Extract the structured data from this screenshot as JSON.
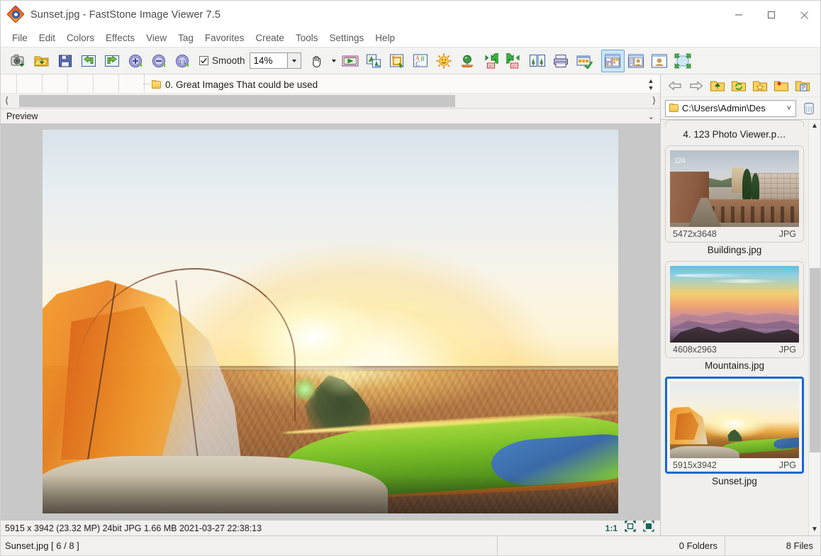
{
  "window": {
    "title": "Sunset.jpg  -  FastStone Image Viewer 7.5",
    "app_icon": "faststone-logo-icon",
    "controls": {
      "minimize": "minimize-button",
      "maximize": "maximize-button",
      "close": "close-button"
    }
  },
  "menubar": {
    "items": [
      "File",
      "Edit",
      "Colors",
      "Effects",
      "View",
      "Tag",
      "Favorites",
      "Create",
      "Tools",
      "Settings",
      "Help"
    ]
  },
  "toolbar": {
    "buttons": [
      {
        "name": "capture-screen-icon"
      },
      {
        "name": "open-folder-icon"
      },
      {
        "name": "save-as-icon"
      },
      {
        "name": "previous-image-icon"
      },
      {
        "name": "next-image-icon"
      },
      {
        "name": "zoom-in-icon"
      },
      {
        "name": "zoom-out-icon"
      },
      {
        "name": "actual-size-icon"
      }
    ],
    "smooth": {
      "label": "Smooth",
      "checked": true
    },
    "zoom": {
      "value": "14%",
      "dropdown": "zoom-dropdown-caret"
    },
    "buttons2": [
      {
        "name": "pan-hand-icon"
      },
      {
        "name": "slideshow-icon"
      },
      {
        "name": "resize-resample-icon"
      },
      {
        "name": "crop-board-icon"
      },
      {
        "name": "draw-text-icon"
      },
      {
        "name": "adjust-lighting-icon"
      },
      {
        "name": "red-eye-removal-icon"
      },
      {
        "name": "rotate-left-icon"
      },
      {
        "name": "rotate-right-icon"
      },
      {
        "name": "compare-images-icon"
      },
      {
        "name": "print-icon"
      },
      {
        "name": "email-icon"
      },
      {
        "name": "thumbnail-view-icon"
      },
      {
        "name": "filmstrip-view-icon"
      },
      {
        "name": "preview-only-icon"
      },
      {
        "name": "fullscreen-icon"
      }
    ]
  },
  "tree": {
    "folder_label": "0. Great Images That  could be used",
    "folder_icon": "folder-icon",
    "spinner": "tree-spinner"
  },
  "preview_panel": {
    "header_label": "Preview",
    "collapse_icon": "double-chevron-down-icon"
  },
  "navbar": {
    "buttons": [
      {
        "name": "back-arrow-icon"
      },
      {
        "name": "forward-arrow-icon"
      },
      {
        "name": "up-folder-icon"
      },
      {
        "name": "refresh-folder-icon"
      },
      {
        "name": "favorites-folder-icon"
      },
      {
        "name": "new-folder-icon"
      },
      {
        "name": "copy-folder-icon"
      }
    ]
  },
  "path": {
    "value": "C:\\Users\\Admin\\Des",
    "folder_icon": "folder-icon",
    "dropdown_icon": "chevron-down-icon",
    "delete_icon": "trash-icon"
  },
  "thumbnails": [
    {
      "name": "4. 123 Photo Viewer.p…",
      "partial": true
    },
    {
      "name": "Buildings.jpg",
      "dimensions": "5472x3648",
      "format": "JPG",
      "art": "art-buildings",
      "selected": false
    },
    {
      "name": "Mountains.jpg",
      "dimensions": "4608x2963",
      "format": "JPG",
      "art": "art-mountains",
      "selected": false
    },
    {
      "name": "Sunset.jpg",
      "dimensions": "5915x3942",
      "format": "JPG",
      "art": "art-sunset",
      "selected": true
    }
  ],
  "imageinfo": {
    "text": "5915 x 3942 (23.32 MP)  24bit  JPG   1.66 MB   2021-03-27 22:38:13",
    "ratio": "1:1",
    "fit_icon": "fit-to-window-icon",
    "fullsize_icon": "actual-pixels-icon"
  },
  "statusbar": {
    "file": "Sunset.jpg [ 6 / 8 ]",
    "folders": "0 Folders",
    "files": "8 Files"
  },
  "colors": {
    "accent": "#1668d0",
    "toolbar_bg": "#f3f3f1",
    "panel_bg": "#f0efeb",
    "selection": "#cbe6fb"
  }
}
